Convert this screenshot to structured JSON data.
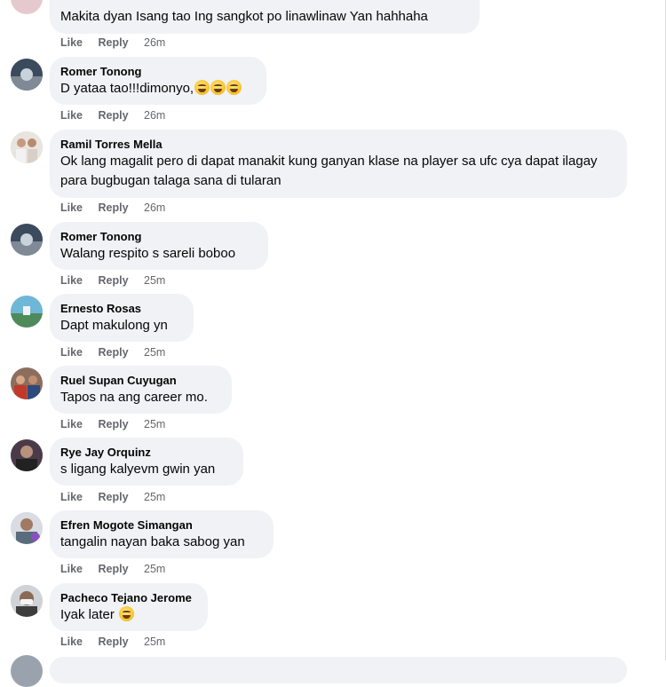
{
  "first": {
    "text": "Makita dyan Isang tao Ing sangkot po linawlinaw Yan hahhaha",
    "like": "Like",
    "reply": "Reply",
    "time": "26m"
  },
  "comments": [
    {
      "author": "Romer Tonong",
      "text": "D yataa tao!!!dimonyo,",
      "emojis": 3,
      "like": "Like",
      "reply": "Reply",
      "time": "26m"
    },
    {
      "author": "Ramil Torres Mella",
      "text": "Ok lang magalit pero di dapat manakit kung ganyan klase na player sa ufc cya dapat ilagay para bugbugan talaga sana di tularan",
      "emojis": 0,
      "like": "Like",
      "reply": "Reply",
      "time": "26m"
    },
    {
      "author": "Romer Tonong",
      "text": "Walang respito s sareli boboo",
      "emojis": 0,
      "like": "Like",
      "reply": "Reply",
      "time": "25m"
    },
    {
      "author": "Ernesto Rosas",
      "text": "Dapt makulong yn",
      "emojis": 0,
      "like": "Like",
      "reply": "Reply",
      "time": "25m"
    },
    {
      "author": "Ruel Supan Cuyugan",
      "text": "Tapos na ang career mo.",
      "emojis": 0,
      "like": "Like",
      "reply": "Reply",
      "time": "25m"
    },
    {
      "author": "Rye Jay Orquinz",
      "text": "s ligang kalyevm gwin yan",
      "emojis": 0,
      "like": "Like",
      "reply": "Reply",
      "time": "25m"
    },
    {
      "author": "Efren Mogote Simangan",
      "text": "tangalin nayan baka sabog yan",
      "emojis": 0,
      "like": "Like",
      "reply": "Reply",
      "time": "25m"
    },
    {
      "author": "Pacheco Tejano Jerome",
      "text": "Iyak later",
      "emojis": 1,
      "like": "Like",
      "reply": "Reply",
      "time": "25m"
    }
  ],
  "colors": {
    "bubble": "#f0f2f5",
    "meta": "#65676b",
    "text": "#050505"
  }
}
